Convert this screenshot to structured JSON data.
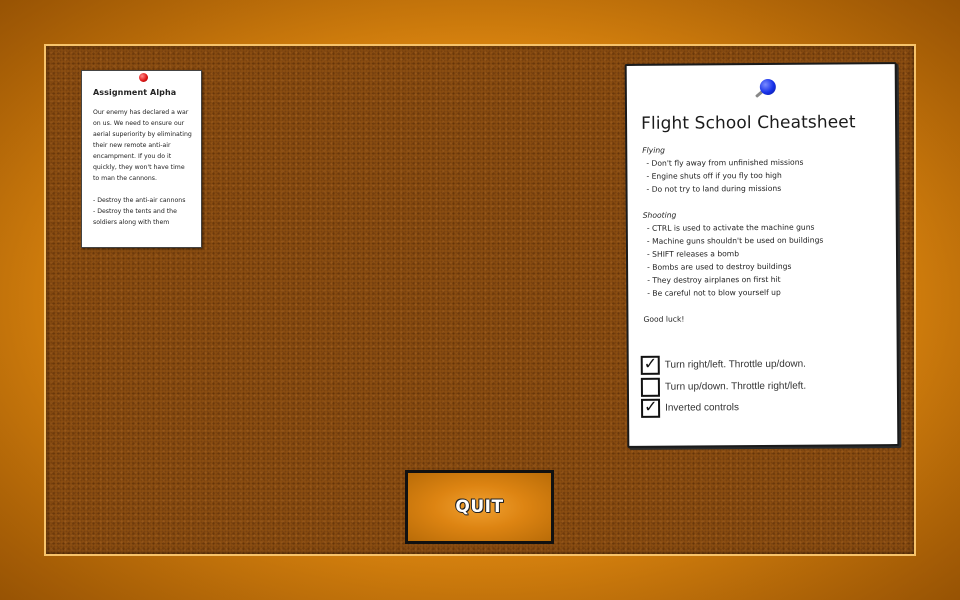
{
  "assignment": {
    "title": "Assignment Alpha",
    "body_lines": [
      "Our enemy has declared a war",
      "on us. We need to ensure our",
      "aerial superiority by eliminating",
      "their new remote anti-air",
      "encampment. If you do it",
      "quickly, they won't have time",
      "to man the cannons."
    ],
    "objectives": [
      "- Destroy the anti-air cannons",
      "- Destroy the tents and the",
      "soldiers along with them"
    ]
  },
  "cheatsheet": {
    "title": "Flight School Cheatsheet",
    "flying_heading": "Flying",
    "flying_items": [
      "- Don't fly away from unfinished missions",
      "- Engine shuts off if you fly too high",
      "- Do not try to land during missions"
    ],
    "shooting_heading": "Shooting",
    "shooting_items": [
      "- CTRL is used to activate the machine guns",
      "- Machine guns shouldn't be used on buildings",
      "- SHIFT releases a bomb",
      "- Bombs are used to destroy buildings",
      "- They destroy airplanes on first hit",
      "- Be careful not to blow yourself up"
    ],
    "closing": "Good luck!",
    "options": [
      {
        "label": "Turn right/left. Throttle up/down.",
        "checked": true
      },
      {
        "label": "Turn up/down. Throttle right/left.",
        "checked": false
      },
      {
        "label": "Inverted controls",
        "checked": true
      }
    ]
  },
  "quit_label": "QUIT",
  "colors": {
    "frame": "#d9840f",
    "board": "#8d4f12",
    "pin_red": "#e01818",
    "pin_blue": "#1630e8"
  },
  "tick_glyph": "✓"
}
